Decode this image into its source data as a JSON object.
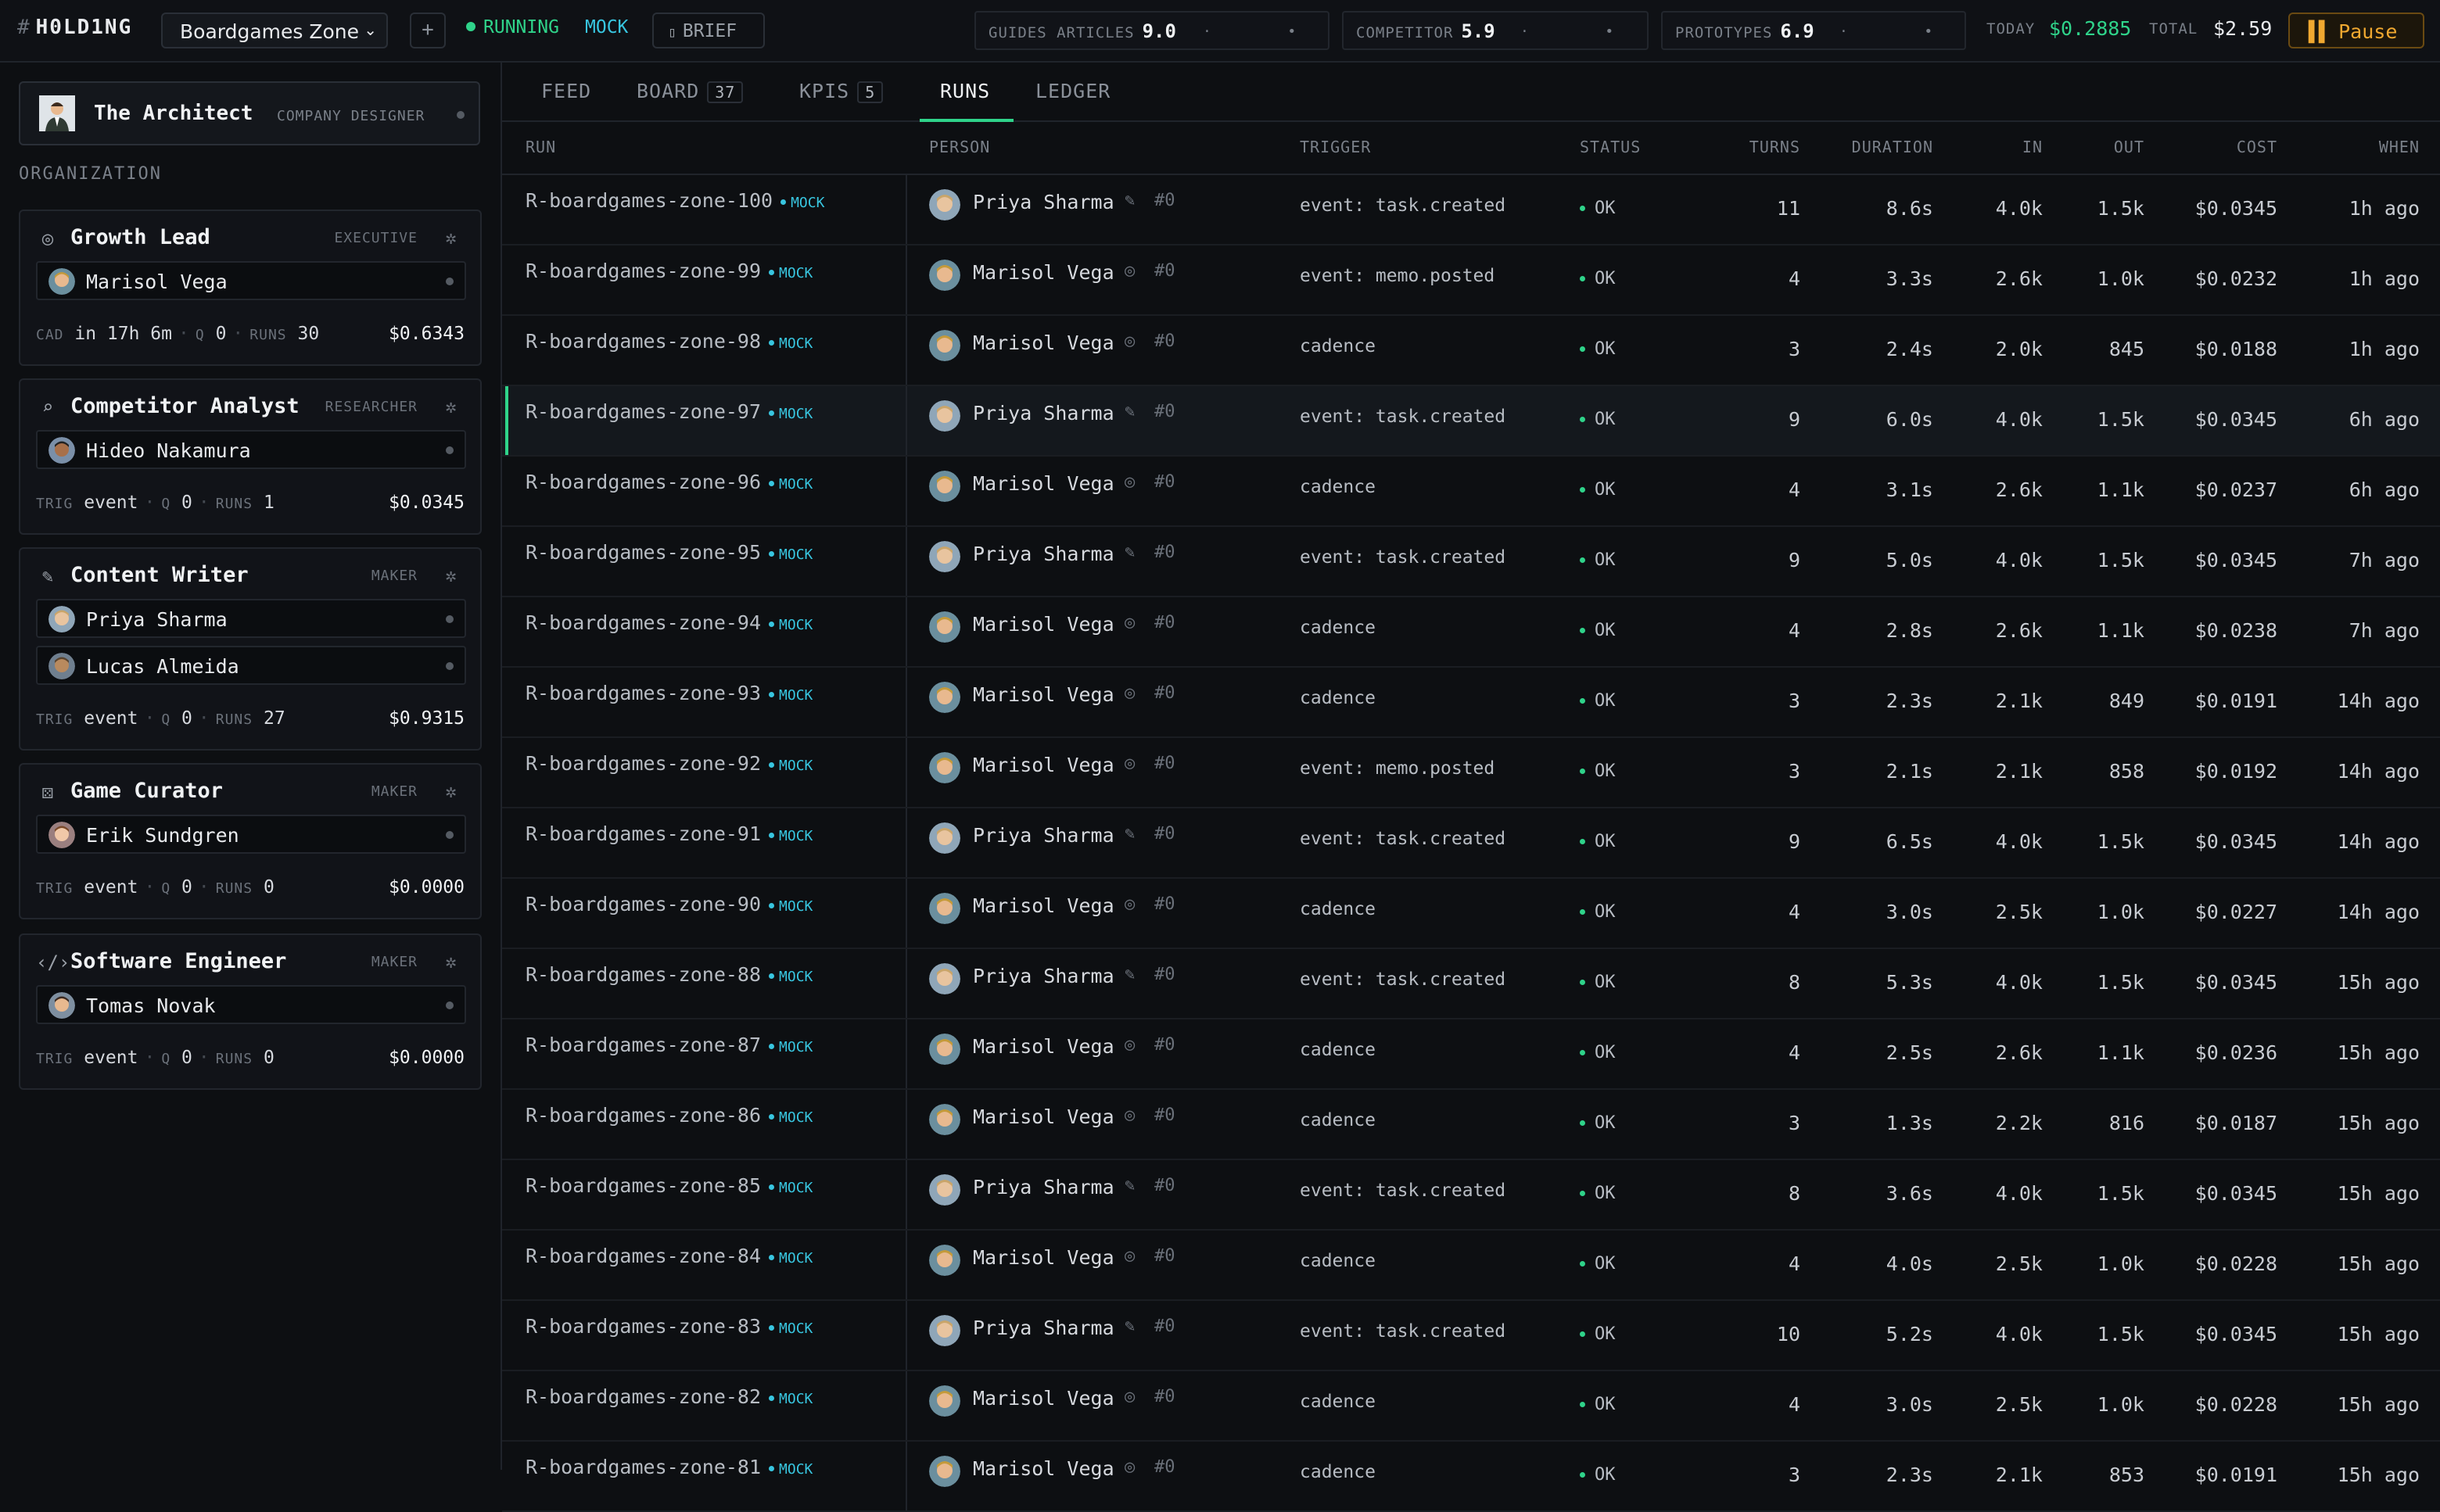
{
  "topbar": {
    "logo_hash": "#",
    "logo": "H0LD1NG",
    "company": "Boardgames Zone",
    "add_label": "+",
    "status": "RUNNING",
    "mode": "MOCK",
    "brief_label": "BRIEF",
    "metrics": [
      {
        "label": "GUIDES ARTICLES",
        "value": "9.0"
      },
      {
        "label": "COMPETITOR",
        "value": "5.9"
      },
      {
        "label": "PROTOTYPES",
        "value": "6.9"
      }
    ],
    "today_label": "TODAY",
    "today_value": "$0.2885",
    "total_label": "TOTAL",
    "total_value": "$2.59",
    "pause_label": "Pause"
  },
  "sidebar": {
    "architect": {
      "name": "The Architect",
      "role": "COMPANY DESIGNER"
    },
    "org_label": "ORGANIZATION",
    "roles": [
      {
        "title": "Growth Lead",
        "type": "EXECUTIVE",
        "icon": "target-icon",
        "people": [
          "Marisol Vega"
        ],
        "trig_label": "CAD",
        "trig": "in 17h 6m",
        "q": "0",
        "runs": "30",
        "cost": "$0.6343"
      },
      {
        "title": "Competitor Analyst",
        "type": "RESEARCHER",
        "icon": "search-icon",
        "people": [
          "Hideo Nakamura"
        ],
        "trig_label": "TRIG",
        "trig": "event",
        "q": "0",
        "runs": "1",
        "cost": "$0.0345"
      },
      {
        "title": "Content Writer",
        "type": "MAKER",
        "icon": "feather-icon",
        "people": [
          "Priya Sharma",
          "Lucas Almeida"
        ],
        "trig_label": "TRIG",
        "trig": "event",
        "q": "0",
        "runs": "27",
        "cost": "$0.9315"
      },
      {
        "title": "Game Curator",
        "type": "MAKER",
        "icon": "dice-icon",
        "people": [
          "Erik Sundgren"
        ],
        "trig_label": "TRIG",
        "trig": "event",
        "q": "0",
        "runs": "0",
        "cost": "$0.0000"
      },
      {
        "title": "Software Engineer",
        "type": "MAKER",
        "icon": "code-icon",
        "people": [
          "Tomas Novak"
        ],
        "trig_label": "TRIG",
        "trig": "event",
        "q": "0",
        "runs": "0",
        "cost": "$0.0000"
      }
    ],
    "q_label": "Q",
    "runs_label": "RUNS"
  },
  "tabs": [
    {
      "label": "FEED"
    },
    {
      "label": "BOARD",
      "count": "37"
    },
    {
      "label": "KPIS",
      "count": "5"
    },
    {
      "label": "RUNS",
      "active": true
    },
    {
      "label": "LEDGER"
    }
  ],
  "table": {
    "headers": [
      "RUN",
      "PERSON",
      "TRIGGER",
      "STATUS",
      "TURNS",
      "DURATION",
      "IN",
      "OUT",
      "COST",
      "WHEN"
    ],
    "mock_label": "MOCK",
    "rows": [
      {
        "run": "R-boardgames-zone-100",
        "person": "Priya Sharma",
        "picon": "feather",
        "num": "#0",
        "trigger": "event: task.created",
        "status": "OK",
        "turns": "11",
        "duration": "8.6s",
        "in": "4.0k",
        "out": "1.5k",
        "cost": "$0.0345",
        "when": "1h ago"
      },
      {
        "run": "R-boardgames-zone-99",
        "person": "Marisol Vega",
        "picon": "target",
        "num": "#0",
        "trigger": "event: memo.posted",
        "status": "OK",
        "turns": "4",
        "duration": "3.3s",
        "in": "2.6k",
        "out": "1.0k",
        "cost": "$0.0232",
        "when": "1h ago"
      },
      {
        "run": "R-boardgames-zone-98",
        "person": "Marisol Vega",
        "picon": "target",
        "num": "#0",
        "trigger": "cadence",
        "status": "OK",
        "turns": "3",
        "duration": "2.4s",
        "in": "2.0k",
        "out": "845",
        "cost": "$0.0188",
        "when": "1h ago"
      },
      {
        "run": "R-boardgames-zone-97",
        "person": "Priya Sharma",
        "picon": "feather",
        "num": "#0",
        "trigger": "event: task.created",
        "status": "OK",
        "turns": "9",
        "duration": "6.0s",
        "in": "4.0k",
        "out": "1.5k",
        "cost": "$0.0345",
        "when": "6h ago",
        "selected": true
      },
      {
        "run": "R-boardgames-zone-96",
        "person": "Marisol Vega",
        "picon": "target",
        "num": "#0",
        "trigger": "cadence",
        "status": "OK",
        "turns": "4",
        "duration": "3.1s",
        "in": "2.6k",
        "out": "1.1k",
        "cost": "$0.0237",
        "when": "6h ago"
      },
      {
        "run": "R-boardgames-zone-95",
        "person": "Priya Sharma",
        "picon": "feather",
        "num": "#0",
        "trigger": "event: task.created",
        "status": "OK",
        "turns": "9",
        "duration": "5.0s",
        "in": "4.0k",
        "out": "1.5k",
        "cost": "$0.0345",
        "when": "7h ago"
      },
      {
        "run": "R-boardgames-zone-94",
        "person": "Marisol Vega",
        "picon": "target",
        "num": "#0",
        "trigger": "cadence",
        "status": "OK",
        "turns": "4",
        "duration": "2.8s",
        "in": "2.6k",
        "out": "1.1k",
        "cost": "$0.0238",
        "when": "7h ago"
      },
      {
        "run": "R-boardgames-zone-93",
        "person": "Marisol Vega",
        "picon": "target",
        "num": "#0",
        "trigger": "cadence",
        "status": "OK",
        "turns": "3",
        "duration": "2.3s",
        "in": "2.1k",
        "out": "849",
        "cost": "$0.0191",
        "when": "14h ago"
      },
      {
        "run": "R-boardgames-zone-92",
        "person": "Marisol Vega",
        "picon": "target",
        "num": "#0",
        "trigger": "event: memo.posted",
        "status": "OK",
        "turns": "3",
        "duration": "2.1s",
        "in": "2.1k",
        "out": "858",
        "cost": "$0.0192",
        "when": "14h ago"
      },
      {
        "run": "R-boardgames-zone-91",
        "person": "Priya Sharma",
        "picon": "feather",
        "num": "#0",
        "trigger": "event: task.created",
        "status": "OK",
        "turns": "9",
        "duration": "6.5s",
        "in": "4.0k",
        "out": "1.5k",
        "cost": "$0.0345",
        "when": "14h ago"
      },
      {
        "run": "R-boardgames-zone-90",
        "person": "Marisol Vega",
        "picon": "target",
        "num": "#0",
        "trigger": "cadence",
        "status": "OK",
        "turns": "4",
        "duration": "3.0s",
        "in": "2.5k",
        "out": "1.0k",
        "cost": "$0.0227",
        "when": "14h ago"
      },
      {
        "run": "R-boardgames-zone-88",
        "person": "Priya Sharma",
        "picon": "feather",
        "num": "#0",
        "trigger": "event: task.created",
        "status": "OK",
        "turns": "8",
        "duration": "5.3s",
        "in": "4.0k",
        "out": "1.5k",
        "cost": "$0.0345",
        "when": "15h ago"
      },
      {
        "run": "R-boardgames-zone-87",
        "person": "Marisol Vega",
        "picon": "target",
        "num": "#0",
        "trigger": "cadence",
        "status": "OK",
        "turns": "4",
        "duration": "2.5s",
        "in": "2.6k",
        "out": "1.1k",
        "cost": "$0.0236",
        "when": "15h ago"
      },
      {
        "run": "R-boardgames-zone-86",
        "person": "Marisol Vega",
        "picon": "target",
        "num": "#0",
        "trigger": "cadence",
        "status": "OK",
        "turns": "3",
        "duration": "1.3s",
        "in": "2.2k",
        "out": "816",
        "cost": "$0.0187",
        "when": "15h ago"
      },
      {
        "run": "R-boardgames-zone-85",
        "person": "Priya Sharma",
        "picon": "feather",
        "num": "#0",
        "trigger": "event: task.created",
        "status": "OK",
        "turns": "8",
        "duration": "3.6s",
        "in": "4.0k",
        "out": "1.5k",
        "cost": "$0.0345",
        "when": "15h ago"
      },
      {
        "run": "R-boardgames-zone-84",
        "person": "Marisol Vega",
        "picon": "target",
        "num": "#0",
        "trigger": "cadence",
        "status": "OK",
        "turns": "4",
        "duration": "4.0s",
        "in": "2.5k",
        "out": "1.0k",
        "cost": "$0.0228",
        "when": "15h ago"
      },
      {
        "run": "R-boardgames-zone-83",
        "person": "Priya Sharma",
        "picon": "feather",
        "num": "#0",
        "trigger": "event: task.created",
        "status": "OK",
        "turns": "10",
        "duration": "5.2s",
        "in": "4.0k",
        "out": "1.5k",
        "cost": "$0.0345",
        "when": "15h ago"
      },
      {
        "run": "R-boardgames-zone-82",
        "person": "Marisol Vega",
        "picon": "target",
        "num": "#0",
        "trigger": "cadence",
        "status": "OK",
        "turns": "4",
        "duration": "3.0s",
        "in": "2.5k",
        "out": "1.0k",
        "cost": "$0.0228",
        "when": "15h ago"
      },
      {
        "run": "R-boardgames-zone-81",
        "person": "Marisol Vega",
        "picon": "target",
        "num": "#0",
        "trigger": "cadence",
        "status": "OK",
        "turns": "3",
        "duration": "2.3s",
        "in": "2.1k",
        "out": "853",
        "cost": "$0.0191",
        "when": "15h ago"
      }
    ]
  },
  "colors": {
    "accent": "#2fd38a",
    "mock": "#38c6e0",
    "pause": "#f0a830"
  }
}
